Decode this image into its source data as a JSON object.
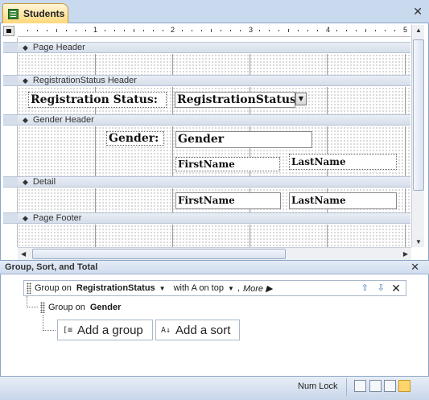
{
  "window": {
    "tab_label": "Students",
    "close_glyph": "✕"
  },
  "designer": {
    "ruler_numbers": [
      "1",
      "2",
      "3",
      "4",
      "5"
    ],
    "sections": {
      "page_header": "Page Header",
      "registration_header": "RegistrationStatus Header",
      "gender_header": "Gender Header",
      "detail": "Detail",
      "page_footer": "Page Footer"
    },
    "controls": {
      "registration_label": "Registration Status:",
      "registration_field": "RegistrationStatus",
      "gender_label": "Gender:",
      "gender_field": "Gender",
      "firstname_label": "FirstName",
      "lastname_label": "LastName",
      "firstname_field": "FirstName",
      "lastname_field": "LastName"
    }
  },
  "group_pane": {
    "title": "Group, Sort, and Total",
    "group_row": {
      "prefix": "Group on",
      "field": "RegistrationStatus",
      "sort": "with A on top",
      "comma": ",",
      "more": "More ▶"
    },
    "sub_group": {
      "prefix": "Group on",
      "field": "Gender"
    },
    "add_group": "Add a group",
    "add_sort": "Add a sort"
  },
  "status_bar": {
    "num_lock": "Num Lock"
  },
  "icons": {
    "tab": "table-icon",
    "section_toggle": "section-arrow-icon",
    "move_up": "move-up-icon",
    "move_down": "move-down-icon",
    "delete": "delete-icon"
  }
}
